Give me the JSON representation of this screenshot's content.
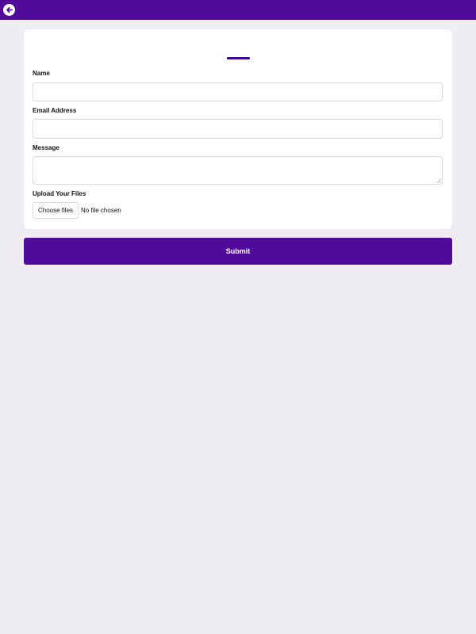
{
  "header": {
    "back_icon": "arrow-left-circle-icon",
    "background_color": "#510b9b"
  },
  "form": {
    "title": "",
    "accent_color": "#3d0a8f",
    "name": {
      "label": "Name",
      "value": "",
      "placeholder": ""
    },
    "email": {
      "label": "Email Address",
      "value": "",
      "placeholder": ""
    },
    "message": {
      "label": "Message",
      "value": "",
      "placeholder": ""
    },
    "upload": {
      "label": "Upload Your Files",
      "button_label": "Choose files",
      "status": "No file chosen"
    }
  },
  "submit": {
    "label": "Submit",
    "color": "#510b9b"
  }
}
